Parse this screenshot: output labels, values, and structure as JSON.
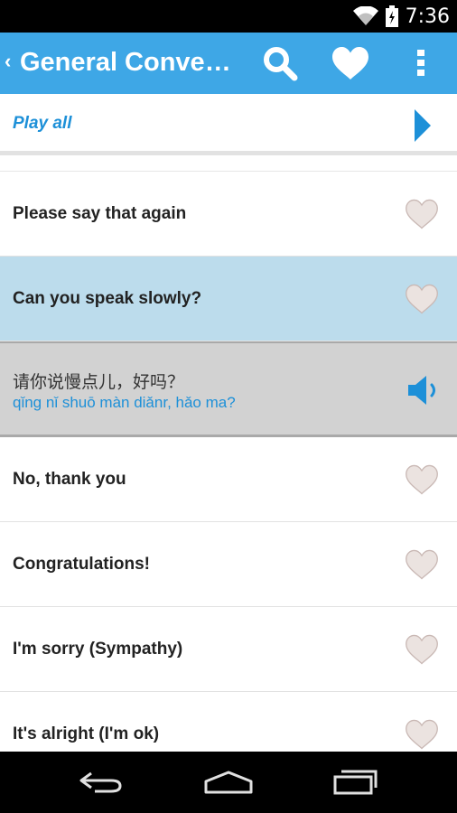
{
  "status_bar": {
    "time": "7:36",
    "icons": [
      "wifi-icon",
      "battery-icon"
    ]
  },
  "action_bar": {
    "title": "General Conversation",
    "back_icon": "chevron-left-icon",
    "actions": [
      "search-icon",
      "heart-icon",
      "overflow-menu-icon"
    ],
    "color": "#3ea7e6"
  },
  "play_all": {
    "label": "Play all",
    "icon": "play-icon"
  },
  "phrases": [
    {
      "text": "Please say that again"
    },
    {
      "text": "Can you speak slowly?",
      "selected": true
    },
    {
      "text": "No, thank you"
    },
    {
      "text": "Congratulations!"
    },
    {
      "text": "I'm sorry (Sympathy)"
    },
    {
      "text": "It's alright (I'm ok)"
    }
  ],
  "expanded": {
    "chinese": "请你说慢点儿，好吗？",
    "pinyin": "qǐng nǐ shuō màn diǎnr, hǎo ma?",
    "icon": "speaker-icon"
  },
  "nav_bar": {
    "icons": [
      "back-icon",
      "home-icon",
      "recents-icon"
    ]
  },
  "colors": {
    "accent": "#3ea7e6",
    "selected_row": "#bcdcec",
    "expanded_row": "#d2d2d2",
    "link_text": "#1d90d8"
  }
}
